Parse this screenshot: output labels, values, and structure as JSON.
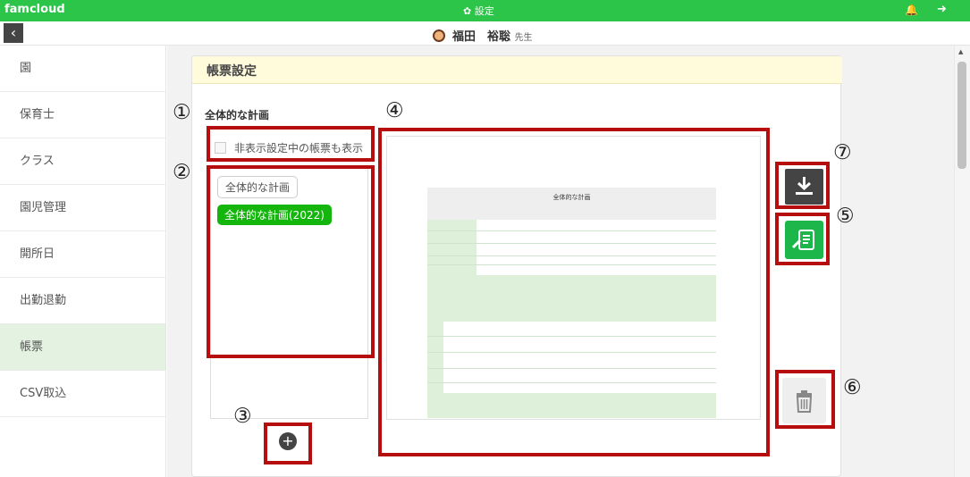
{
  "topbar": {
    "brand": "famcloud",
    "title": "設定"
  },
  "user": {
    "name": "福田　裕聡",
    "suffix": "先生"
  },
  "sidebar": {
    "items": [
      {
        "label": "園"
      },
      {
        "label": "保育士"
      },
      {
        "label": "クラス"
      },
      {
        "label": "園児管理"
      },
      {
        "label": "開所日"
      },
      {
        "label": "出勤退勤"
      },
      {
        "label": "帳票",
        "active": true
      },
      {
        "label": "CSV取込"
      }
    ]
  },
  "main": {
    "header_title": "帳票設定",
    "section_title": "全体的な計画",
    "show_hidden_label": "非表示設定中の帳票も表示",
    "form_list": [
      "全体的な計画",
      "全体的な計画(2022)"
    ],
    "preview": {
      "doc_title": "全体的な計画"
    }
  },
  "annotations": {
    "marks": [
      "①",
      "②",
      "③",
      "④",
      "⑤",
      "⑥",
      "⑦"
    ]
  },
  "colors": {
    "brand_green": "#2dc44a",
    "header_yellow": "#fffbdb",
    "annotation_red": "#b60e0e",
    "selected_chip": "#14b60d"
  }
}
